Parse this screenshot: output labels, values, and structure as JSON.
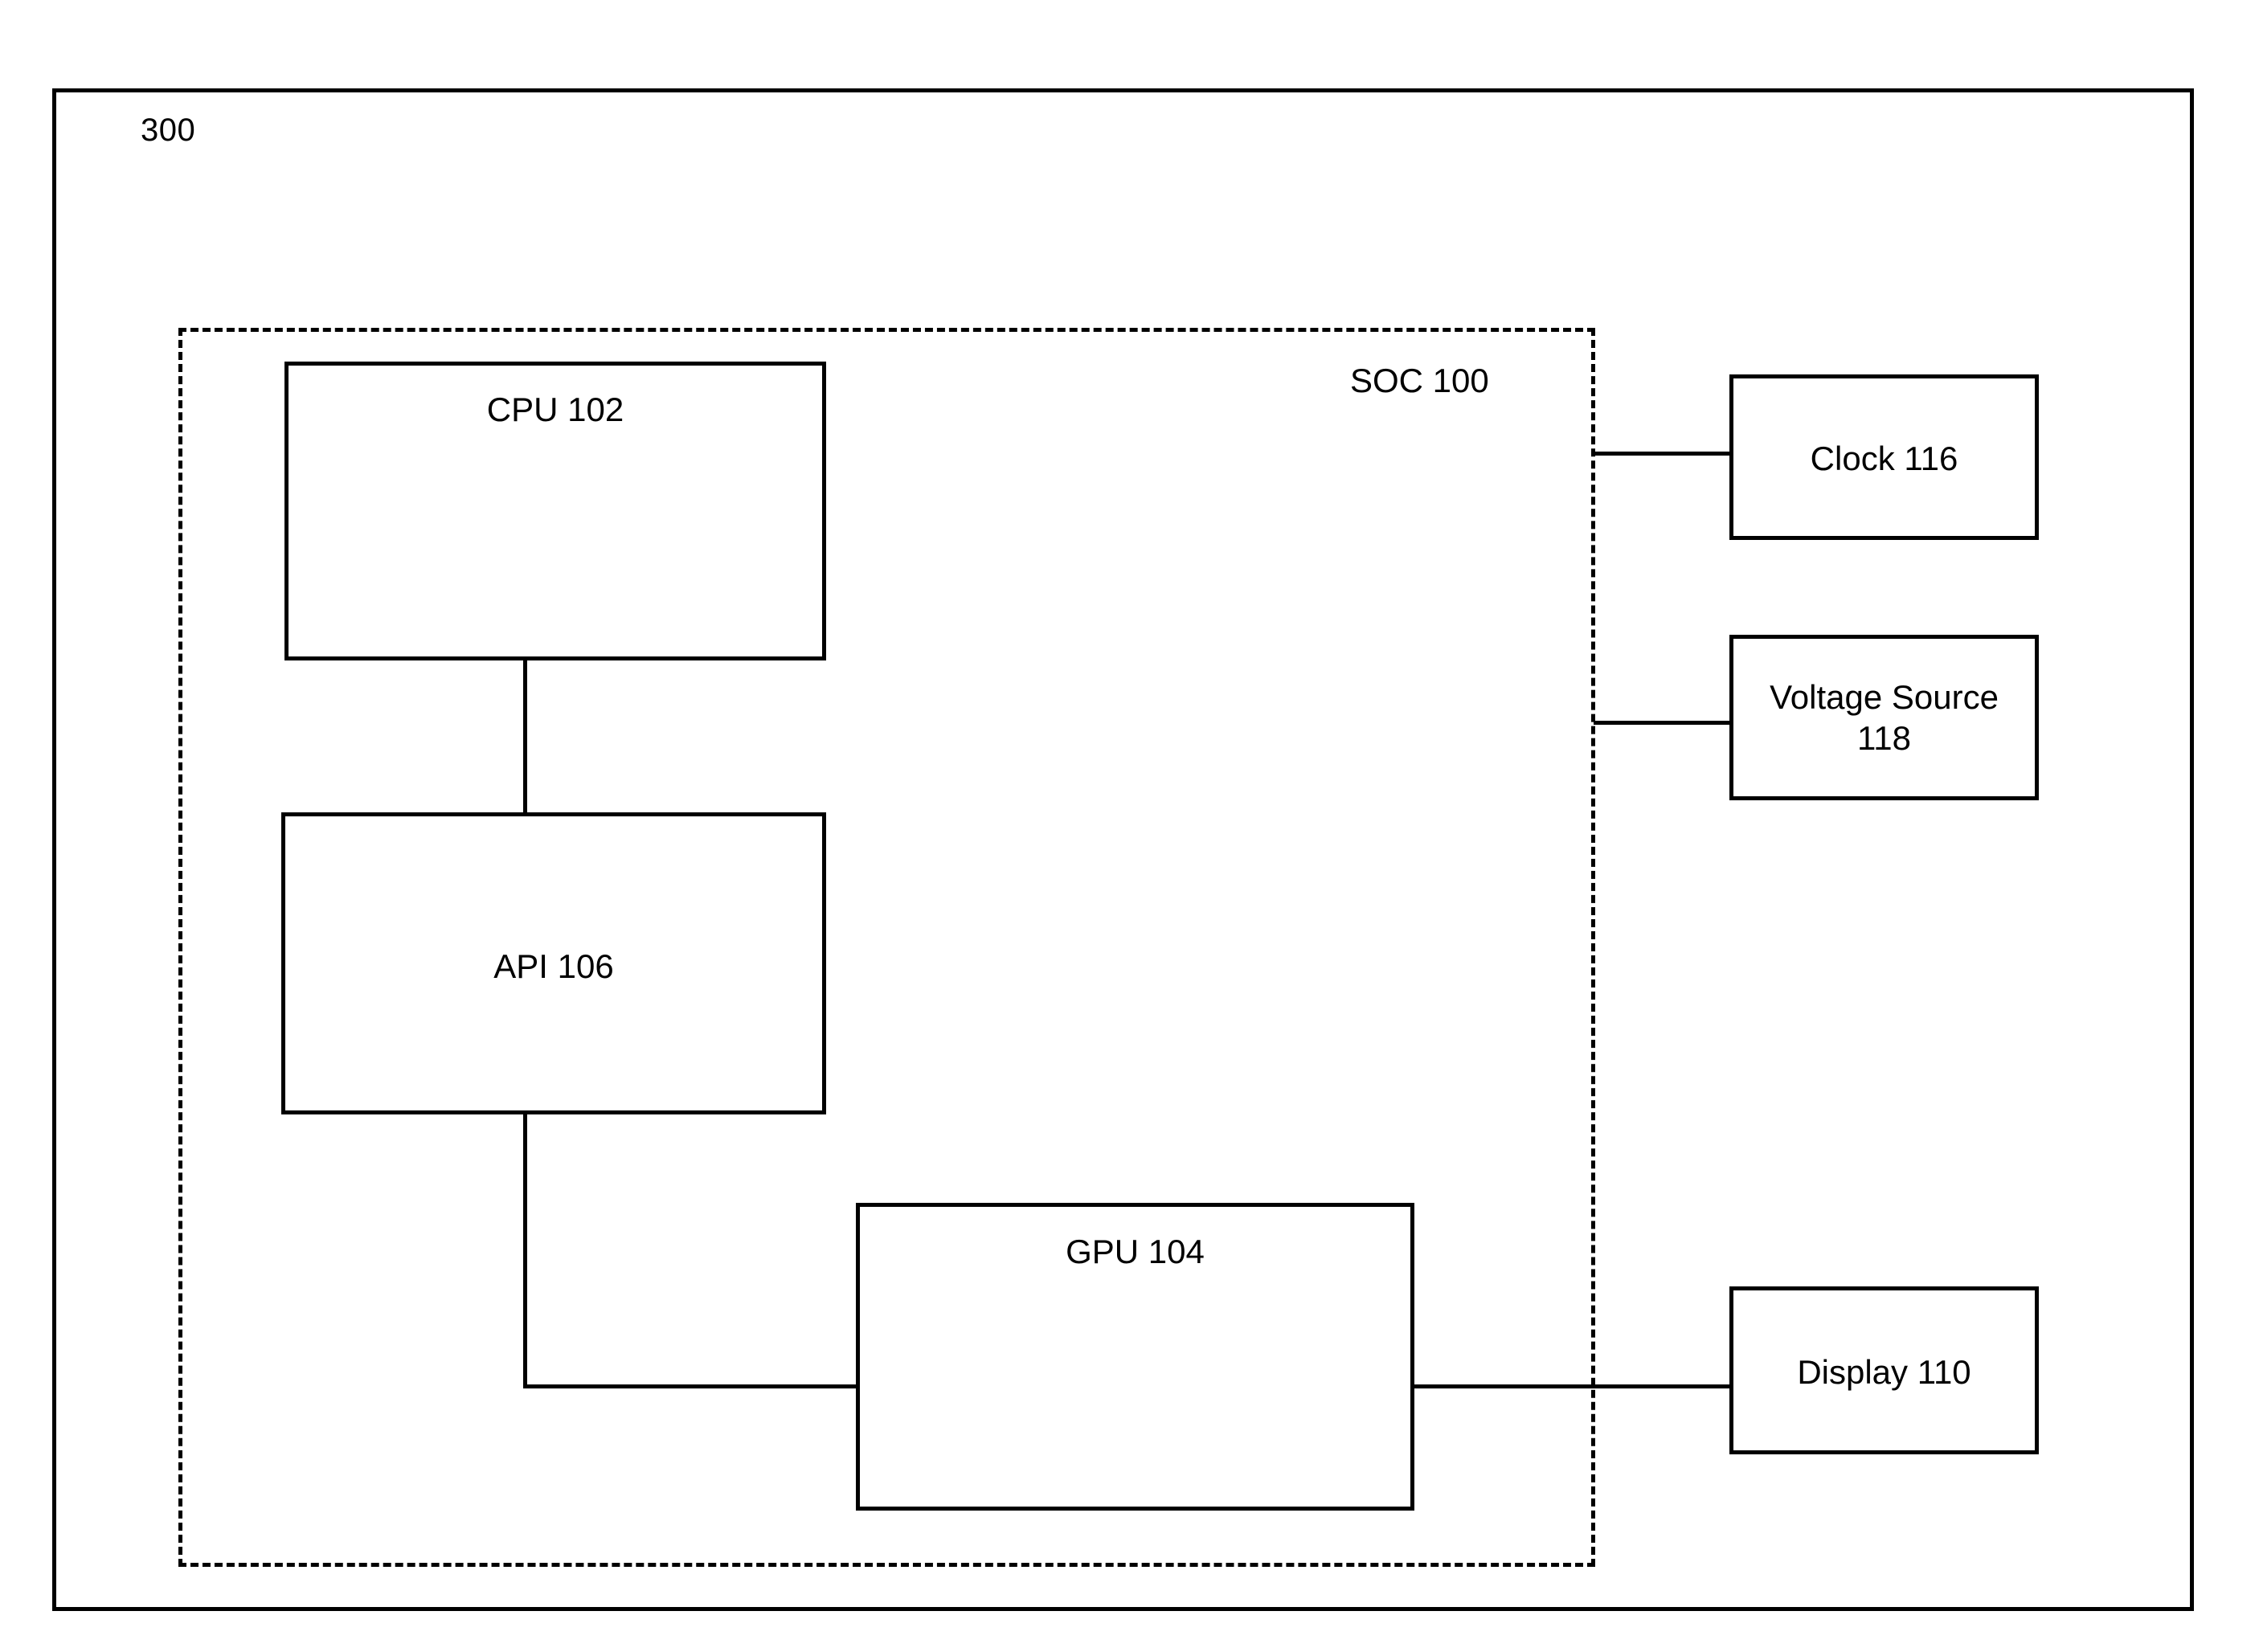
{
  "figure": {
    "number": "300"
  },
  "soc": {
    "label": "SOC 100"
  },
  "blocks": {
    "cpu": {
      "label": "CPU 102"
    },
    "api": {
      "label": "API 106"
    },
    "gpu": {
      "label": "GPU 104"
    },
    "clock": {
      "label": "Clock 116"
    },
    "voltage_source": {
      "label": "Voltage Source\n118"
    },
    "display": {
      "label": "Display 110"
    }
  },
  "connections": [
    {
      "from": "CPU 102",
      "to": "API 106"
    },
    {
      "from": "API 106",
      "to": "GPU 104"
    },
    {
      "from": "GPU 104",
      "to": "Display 110"
    },
    {
      "from": "SOC 100",
      "to": "Clock 116"
    },
    {
      "from": "SOC 100",
      "to": "Voltage Source 118"
    }
  ],
  "colors": {
    "line": "#000000",
    "background": "#ffffff"
  }
}
